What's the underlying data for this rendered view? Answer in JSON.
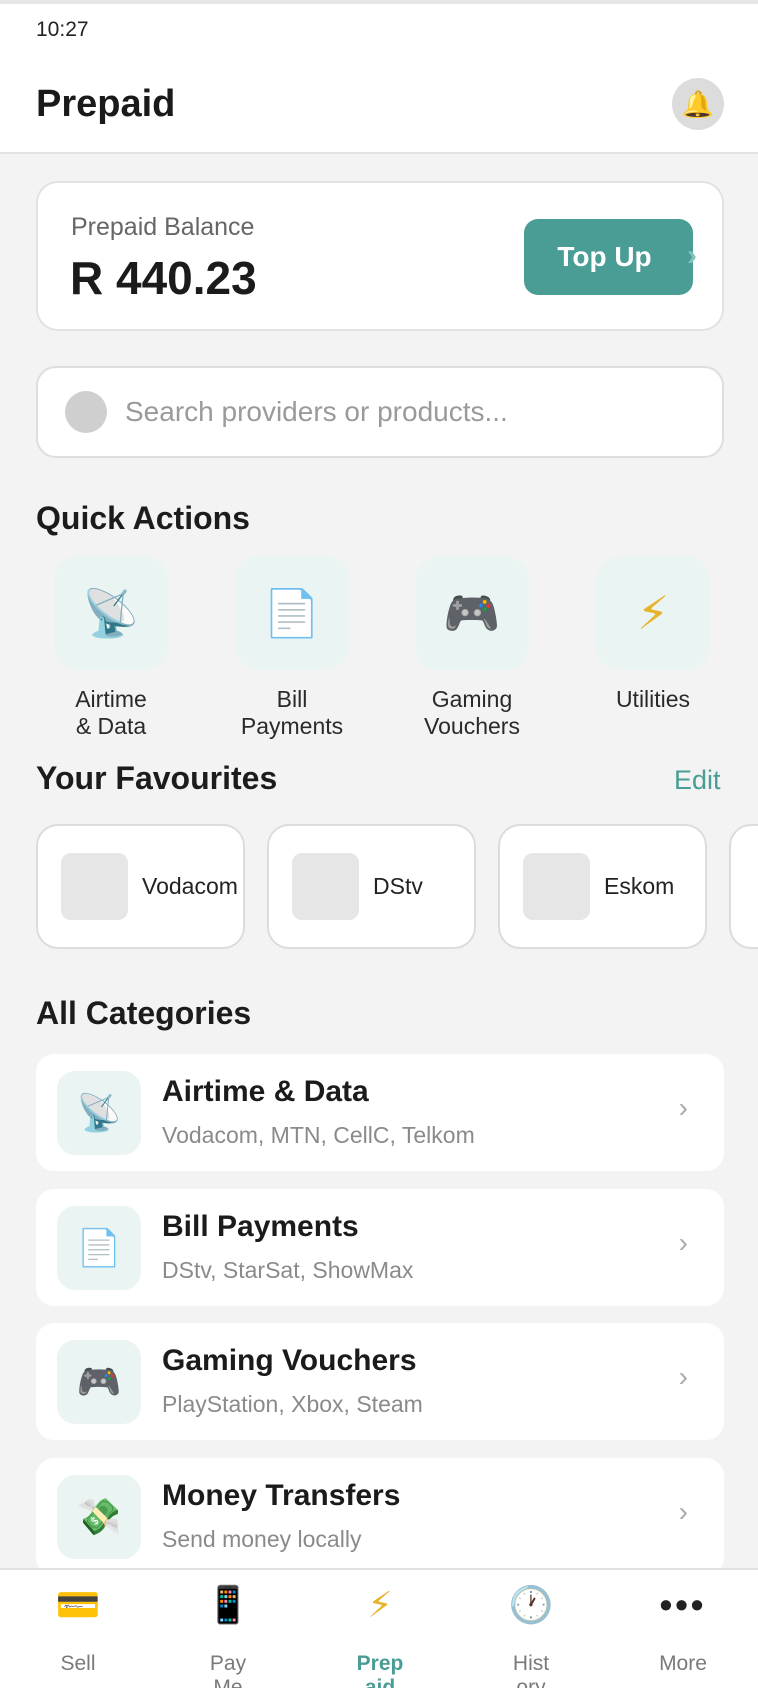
{
  "status_bar": {
    "time": "10:27"
  },
  "header": {
    "title": "Prepaid",
    "bell_icon": "bell-icon"
  },
  "balance": {
    "label": "Prepaid Balance",
    "amount": "R 440.23",
    "top_up_label": "Top Up",
    "chevron": "›"
  },
  "search": {
    "placeholder": "Search providers or products..."
  },
  "quick_actions": {
    "title": "Quick Actions",
    "items": [
      {
        "label": "Airtime\n& Data",
        "icon": "📡"
      },
      {
        "label": "Bill\nPayments",
        "icon": "📄"
      },
      {
        "label": "Gaming\nVouchers",
        "icon": "🎮"
      },
      {
        "label": "Utilities",
        "icon": "⚡"
      }
    ]
  },
  "favourites": {
    "title": "Your Favourites",
    "edit_label": "Edit",
    "items": [
      {
        "name": "Vodacom"
      },
      {
        "name": "DStv"
      },
      {
        "name": "Eskom"
      }
    ]
  },
  "categories": {
    "title": "All Categories",
    "items": [
      {
        "title": "Airtime & Data",
        "subtitle": "Vodacom, MTN, CellC, Telkom",
        "icon": "📡",
        "chevron": "›"
      },
      {
        "title": "Bill Payments",
        "subtitle": "DStv, StarSat, ShowMax",
        "icon": "📄",
        "chevron": "›"
      },
      {
        "title": "Gaming Vouchers",
        "subtitle": "PlayStation, Xbox, Steam",
        "icon": "🎮",
        "chevron": "›"
      },
      {
        "title": "Money Transfers",
        "subtitle": "Send money locally",
        "icon": "💸",
        "chevron": "›"
      }
    ]
  },
  "tab_bar": {
    "items": [
      {
        "label": "Sell",
        "icon": "💳"
      },
      {
        "label": "Pay\nMe",
        "icon": "📱"
      },
      {
        "label": "Prep\naid",
        "icon": "⚡",
        "active": true
      },
      {
        "label": "Hist\nory",
        "icon": "🕐"
      },
      {
        "label": "More",
        "icon": "•••"
      }
    ]
  },
  "colors": {
    "accent": "#4a9d94",
    "background": "#f3f3f3",
    "card": "#ffffff"
  }
}
